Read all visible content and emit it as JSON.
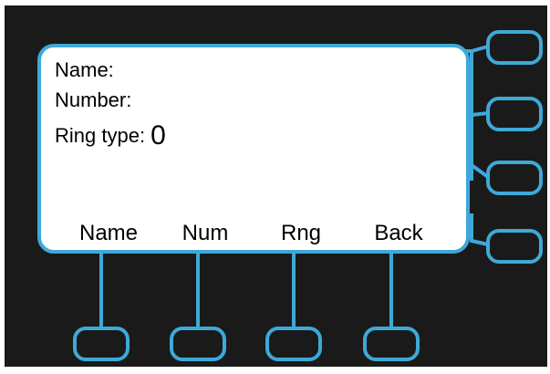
{
  "screen": {
    "fields": [
      {
        "label": "Name:",
        "value": ""
      },
      {
        "label": "Number:",
        "value": ""
      },
      {
        "label": "Ring type:",
        "value": "0"
      }
    ],
    "softkeys": [
      "Name",
      "Num",
      "Rng",
      "Back"
    ]
  },
  "colors": {
    "panel": "#1a1a1a",
    "accent": "#3ea9d8",
    "screen": "#ffffff"
  }
}
